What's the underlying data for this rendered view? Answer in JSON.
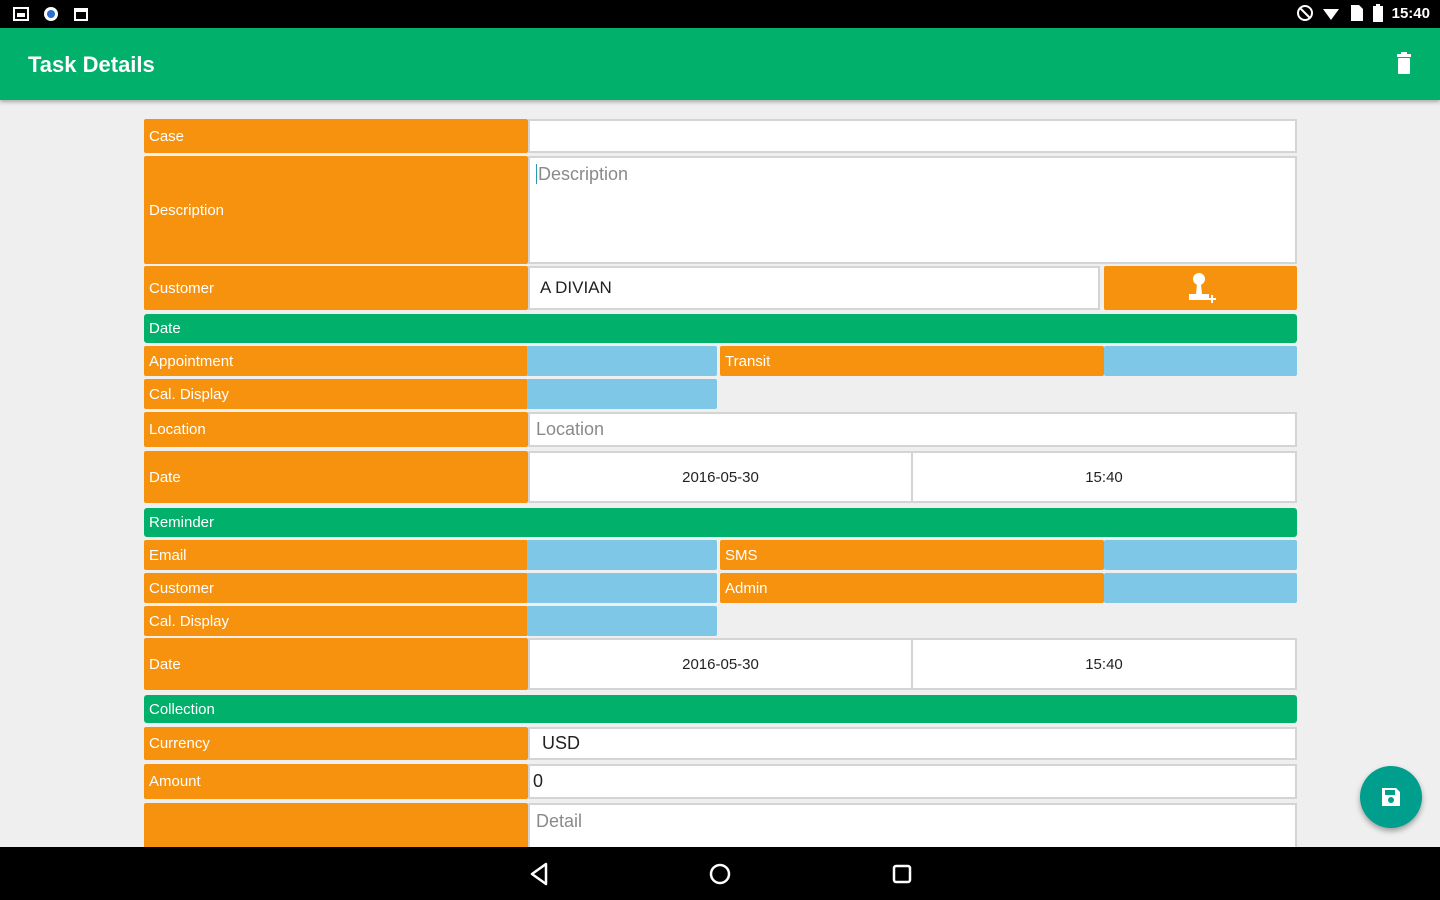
{
  "status_bar": {
    "time": "15:40"
  },
  "app_bar": {
    "title": "Task Details",
    "delete_icon": "trash-icon"
  },
  "form": {
    "case": {
      "label": "Case",
      "value": ""
    },
    "description": {
      "label": "Description",
      "placeholder": "Description"
    },
    "customer": {
      "label": "Customer",
      "value": "A DIVIAN",
      "button_icon": "add-person-icon"
    },
    "date_section": {
      "title": "Date",
      "appointment_label": "Appointment",
      "transit_label": "Transit",
      "cal_display_label": "Cal. Display",
      "location_label": "Location",
      "location_placeholder": "Location",
      "date_label": "Date",
      "date_value": "2016-05-30",
      "time_value": "15:40"
    },
    "reminder_section": {
      "title": "Reminder",
      "email_label": "Email",
      "sms_label": "SMS",
      "customer_label": "Customer",
      "admin_label": "Admin",
      "cal_display_label": "Cal. Display",
      "date_label": "Date",
      "date_value": "2016-05-30",
      "time_value": "15:40"
    },
    "collection_section": {
      "title": "Collection",
      "currency_label": "Currency",
      "currency_value": "USD",
      "amount_label": "Amount",
      "amount_value": "0",
      "detail_placeholder": "Detail"
    }
  },
  "fab": {
    "icon": "save-icon"
  },
  "colors": {
    "primary": "#00b06b",
    "label": "#f6920e",
    "toggle": "#7ec7e6",
    "fab": "#009e8c"
  }
}
